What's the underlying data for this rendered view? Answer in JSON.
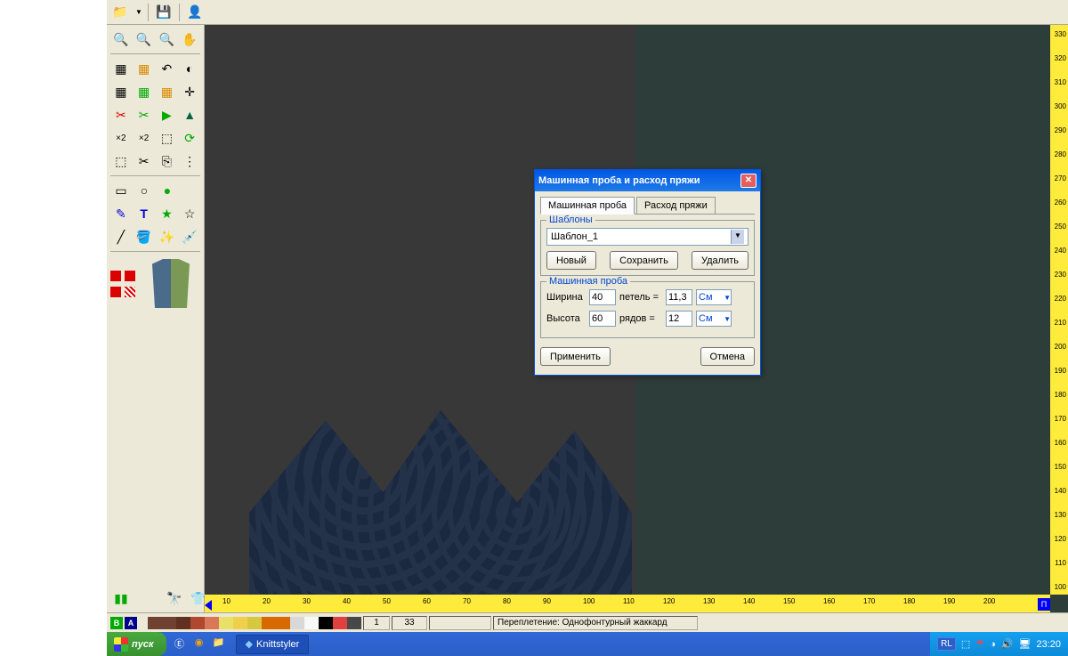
{
  "dialog": {
    "title": "Машинная проба и расход пряжи",
    "tab1": "Машинная проба",
    "tab2": "Расход пряжи",
    "templates_legend": "Шаблоны",
    "template_selected": "Шаблон_1",
    "btn_new": "Новый",
    "btn_save": "Сохранить",
    "btn_delete": "Удалить",
    "gauge_legend": "Машинная проба",
    "width_label": "Ширина",
    "width_value": "40",
    "stitches_label": "петель =",
    "width_cm": "11,3",
    "height_label": "Высота",
    "height_value": "60",
    "rows_label": "рядов  =",
    "height_cm": "12",
    "unit": "См",
    "btn_apply": "Применить",
    "btn_cancel": "Отмена"
  },
  "status": {
    "badge_b": "B",
    "badge_a": "A",
    "coord1": "1",
    "coord2": "33",
    "weave_label": "Переплетение: Однофонтурный жаккард"
  },
  "color_palette": [
    "#704030",
    "#704030",
    "#603020",
    "#b04830",
    "#d87858",
    "#e8e068",
    "#f0d048",
    "#d8c840",
    "#d86800",
    "#d86800",
    "#d8d8d8",
    "#f8f8f8",
    "#000000",
    "#e04040",
    "#484848"
  ],
  "taskbar": {
    "start": "пуск",
    "app_name": "Knittstyler",
    "lang": "RL",
    "time": "23:20"
  },
  "ruler_h_marks": [
    10,
    20,
    30,
    40,
    50,
    60,
    70,
    80,
    90,
    100,
    110,
    120,
    130,
    140,
    150,
    160,
    170,
    180,
    190,
    200
  ],
  "ruler_v_marks": [
    330,
    320,
    310,
    300,
    290,
    280,
    270,
    260,
    250,
    240,
    230,
    220,
    210,
    200,
    190,
    180,
    170,
    160,
    150,
    140,
    130,
    120,
    110,
    100
  ]
}
